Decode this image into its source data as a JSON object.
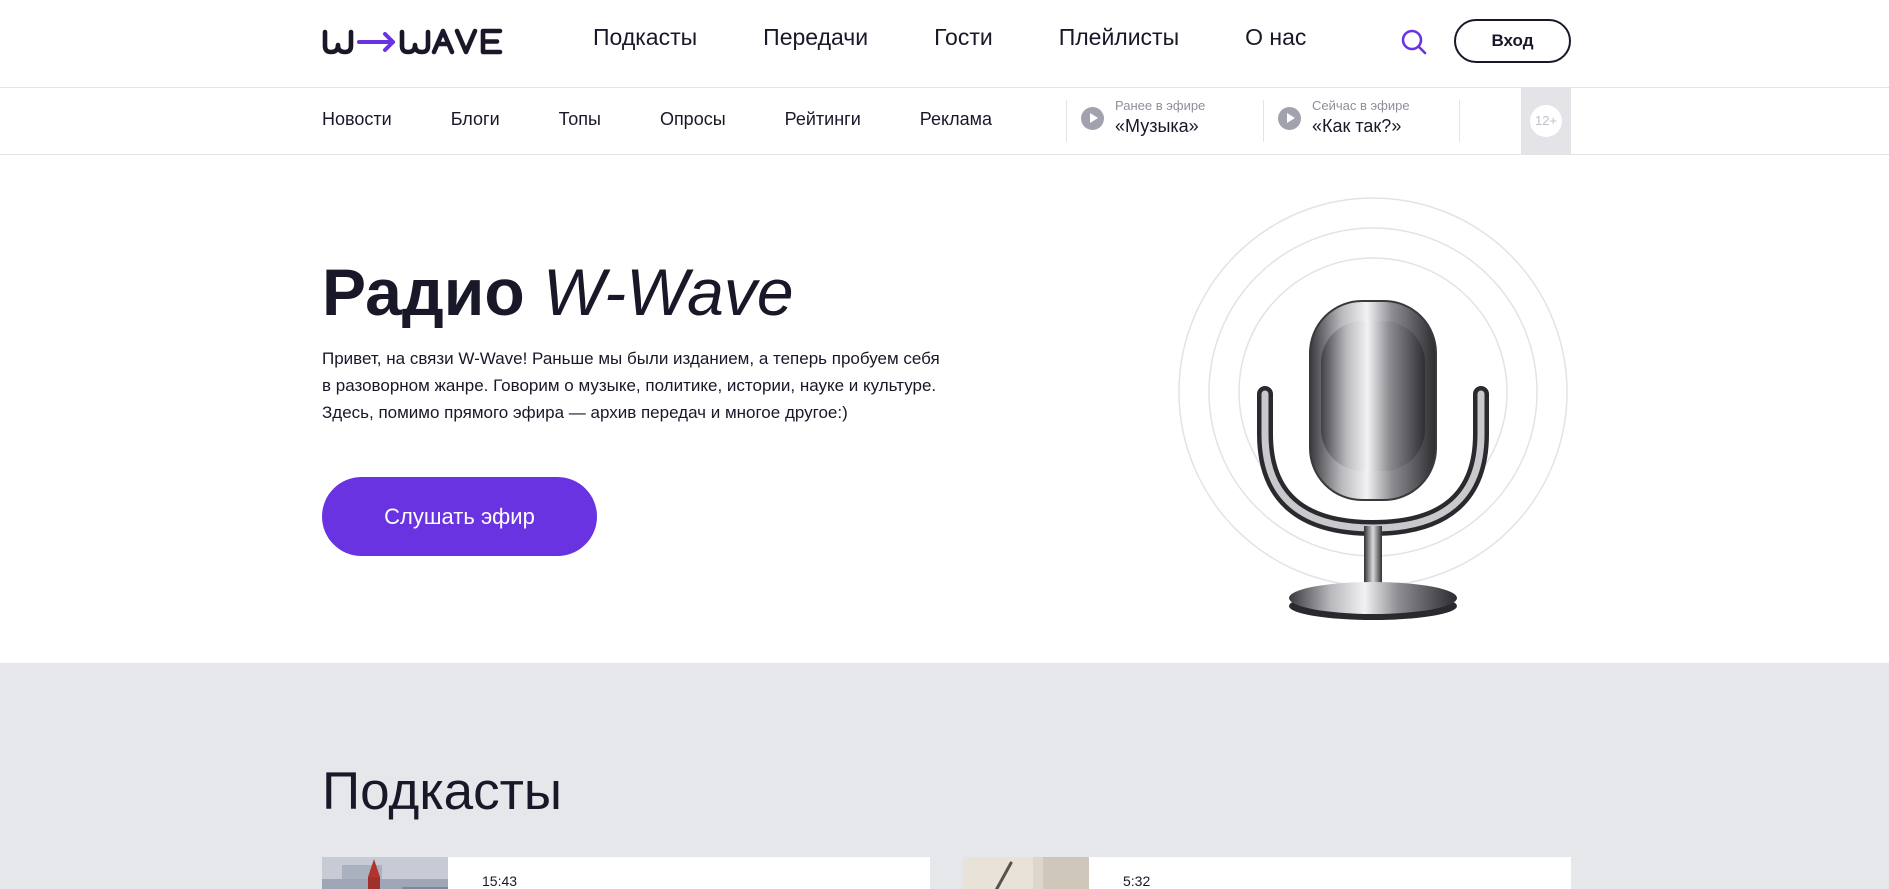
{
  "header": {
    "logo_text": "W→WAVE",
    "nav": [
      "Подкасты",
      "Передачи",
      "Гости",
      "Плейлисты",
      "О нас"
    ],
    "login_label": "Вход"
  },
  "subbar": {
    "nav": [
      "Новости",
      "Блоги",
      "Топы",
      "Опросы",
      "Рейтинги",
      "Реклама"
    ],
    "onair_prev": {
      "label": "Ранее в эфире",
      "title": "«Музыка»"
    },
    "onair_now": {
      "label": "Сейчас в эфире",
      "title": "«Как так?»"
    },
    "age_rating": "12+"
  },
  "hero": {
    "title_bold": "Радио",
    "title_italic": "W-Wave",
    "text_lines": [
      "Привет, на связи W-Wave! Раньше мы были изданием, а теперь пробуем себя",
      "в разоворном жанре. Говорим о музыке, политике, истории, науке и культуре.",
      "Здесь, помимо прямого эфира — архив передач и многое другое:)"
    ],
    "button_label": "Слушать эфир"
  },
  "podcasts": {
    "title": "Подкасты",
    "cards": [
      {
        "time": "15:43"
      },
      {
        "time": "5:32"
      }
    ]
  },
  "colors": {
    "accent": "#6933e1",
    "text": "#181828",
    "muted": "#8f8f9c",
    "section_bg": "#e6e7eb"
  }
}
